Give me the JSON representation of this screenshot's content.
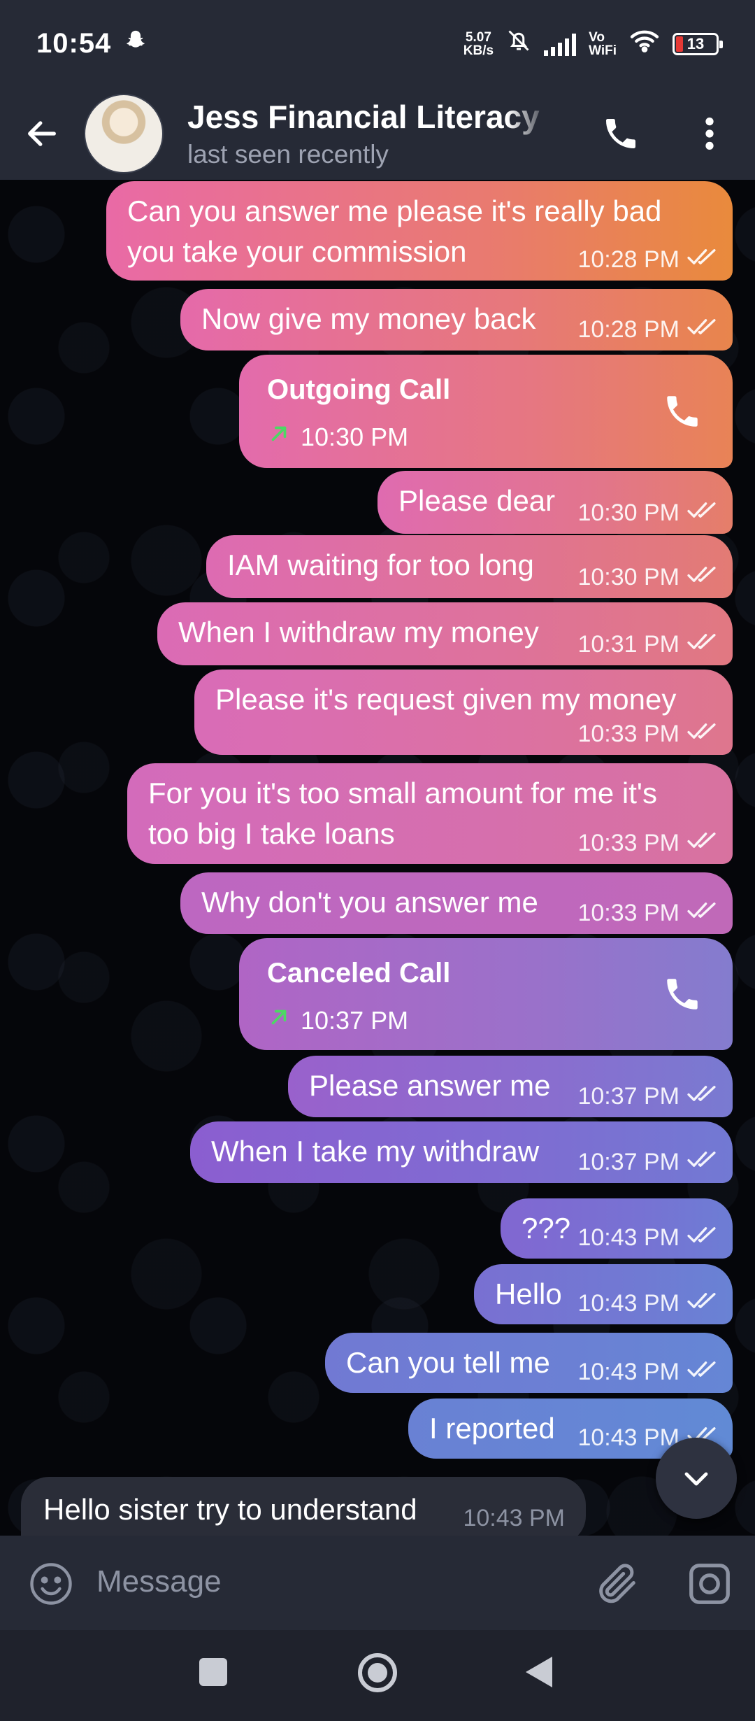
{
  "status_bar": {
    "time": "10:54",
    "net_speed_value": "5.07",
    "net_speed_unit": "KB/s",
    "vowifi_top": "Vo",
    "vowifi_bottom": "WiFi",
    "battery": "13"
  },
  "header": {
    "title": "Jess Financial Literacy",
    "subtitle": "last seen recently"
  },
  "messages": [
    {
      "type": "text",
      "lines": [
        "Can you answer me please it's really bad",
        "you take your commission"
      ],
      "time": "10:28 PM"
    },
    {
      "type": "text",
      "lines": [
        "Now give my money back"
      ],
      "time": "10:28 PM"
    },
    {
      "type": "call",
      "title": "Outgoing Call",
      "time": "10:30 PM"
    },
    {
      "type": "text",
      "lines": [
        "Please dear"
      ],
      "time": "10:30 PM"
    },
    {
      "type": "text",
      "lines": [
        "IAM waiting for too long"
      ],
      "time": "10:30 PM"
    },
    {
      "type": "text",
      "lines": [
        "When I withdraw my money"
      ],
      "time": "10:31 PM"
    },
    {
      "type": "text",
      "lines": [
        "Please it's request given my money"
      ],
      "time": "10:33 PM"
    },
    {
      "type": "text",
      "lines": [
        "For you it's too small amount for me it's",
        "too big I take loans"
      ],
      "time": "10:33 PM"
    },
    {
      "type": "text",
      "lines": [
        "Why don't you answer me"
      ],
      "time": "10:33 PM"
    },
    {
      "type": "call",
      "title": "Canceled Call",
      "time": "10:37 PM"
    },
    {
      "type": "text",
      "lines": [
        "Please answer me"
      ],
      "time": "10:37 PM"
    },
    {
      "type": "text",
      "lines": [
        "When I take my withdraw"
      ],
      "time": "10:37 PM"
    },
    {
      "type": "text",
      "lines": [
        "???"
      ],
      "time": "10:43 PM"
    },
    {
      "type": "text",
      "lines": [
        "Hello"
      ],
      "time": "10:43 PM"
    },
    {
      "type": "text",
      "lines": [
        "Can you tell me"
      ],
      "time": "10:43 PM"
    },
    {
      "type": "text",
      "lines": [
        "I reported"
      ],
      "time": "10:43 PM"
    }
  ],
  "incoming": {
    "text": "Hello sister try to understand",
    "time": "10:43 PM"
  },
  "input": {
    "placeholder": "Message"
  },
  "colors": {
    "accent_green": "#4cd964",
    "bubble_top": "#e96aa6",
    "bubble_mid": "#8a5ed0",
    "bubble_bottom": "#5893d6",
    "bubble_right_orange": "#e98a3c"
  },
  "icons": {
    "header": [
      "back-arrow-icon",
      "phone-icon",
      "more-vertical-icon"
    ],
    "input": [
      "emoji-icon",
      "attach-icon",
      "camera-icon"
    ],
    "nav": [
      "recents-icon",
      "home-icon",
      "back-icon"
    ]
  }
}
